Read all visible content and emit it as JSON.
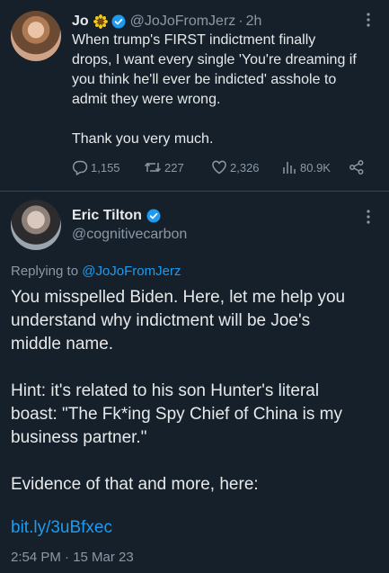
{
  "tweet1": {
    "name": "Jo",
    "handle": "@JoJoFromJerz",
    "time": "2h",
    "text_line1": "When trump's FIRST indictment finally",
    "text_line2": "drops, I want every single 'You're dreaming if",
    "text_line3": "you think he'll ever be indicted' asshole to",
    "text_line4": "admit they were wrong.",
    "text_line5": "Thank you very much.",
    "stats": {
      "replies": "1,155",
      "retweets": "227",
      "likes": "2,326",
      "views": "80.9K"
    }
  },
  "tweet2": {
    "name": "Eric Tilton",
    "handle": "@cognitivecarbon",
    "replying_prefix": "Replying to",
    "replying_to": "@JoJoFromJerz",
    "line1": "You misspelled Biden. Here, let me help you",
    "line2": "understand why indictment will be Joe's",
    "line3": "middle name.",
    "line4": "Hint: it's related to his son Hunter's literal",
    "line5": "boast: \"The Fk*ing Spy Chief of China is my",
    "line6": "business partner.\"",
    "line7": "Evidence of that and more, here:",
    "link": "bit.ly/3uBfxec",
    "timestamp": "2:54 PM · 15 Mar 23"
  },
  "colors": {
    "background": "#15202b",
    "text": "#e7e9ea",
    "muted": "#8b98a5",
    "accent": "#1d9bf0",
    "divider": "#38444d"
  },
  "icons": [
    "sunflower-icon",
    "verified-badge-icon",
    "more-icon",
    "reply-icon",
    "retweet-icon",
    "like-icon",
    "views-icon",
    "share-icon"
  ]
}
